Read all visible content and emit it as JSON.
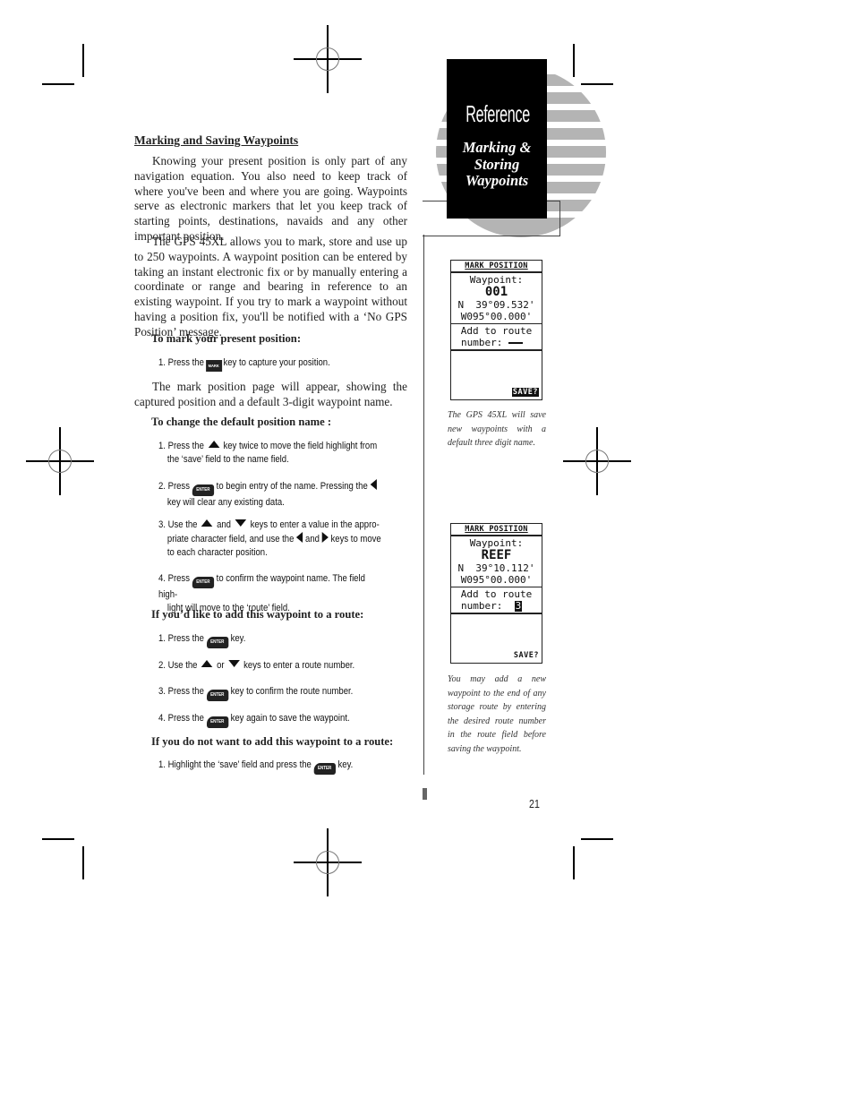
{
  "tab": {
    "title": "Reference",
    "subtitle_lines": [
      "Marking &",
      "Storing",
      "Waypoints"
    ]
  },
  "section": {
    "heading": "Marking and Saving Waypoints",
    "paragraphs": [
      "Knowing your present position is only part of any navigation equation. You also need to keep track of where you've been and where you are going. Waypoints serve as electronic markers that let you keep track of starting points, destinations, navaids and any other important position.",
      "The GPS 45XL allows you to mark, store and use up to 250 waypoints. A waypoint position can be entered by taking an instant electronic fix or by manually entering a coordinate or range and bearing in reference to an existing waypoint. If you try to mark a waypoint without having a position fix, you'll be notified with a ‘No GPS Position’ message.",
      "The mark position page will appear, showing the captured position and a default 3-digit waypoint name."
    ]
  },
  "mark_present": {
    "subheading": "To mark your present position:",
    "step1": {
      "a": "1. Press the",
      "key": "MARK",
      "b": "key to capture your position."
    }
  },
  "change_name": {
    "subheading": "To change the default position name :",
    "step1": {
      "a": "1. Press the",
      "b": "key twice to move the field highlight from",
      "c": "the ‘save’ field to the name field."
    },
    "step2": {
      "a": "2. Press",
      "key": "ENTER",
      "b": "to begin entry of the name. Pressing the",
      "c": "key will clear any existing data."
    },
    "step3": {
      "a": "3. Use the",
      "b": "and",
      "c": "keys to enter a value in the appro-",
      "d": "priate character field, and use the",
      "e": "and",
      "f": "keys to move",
      "g": "to each character position."
    },
    "step4": {
      "a": "4. Press",
      "key": "ENTER",
      "b": "to confirm the waypoint name. The field high-",
      "c": "light will move to the ‘route’ field."
    }
  },
  "add_route": {
    "subheading": "If you’d like to add this waypoint to a route:",
    "step1": {
      "a": "1. Press the",
      "key": "ENTER",
      "b": "key."
    },
    "step2": {
      "a": "2. Use the",
      "b": "or",
      "c": "keys to enter a route number."
    },
    "step3": {
      "a": "3. Press the",
      "key": "ENTER",
      "b": "key to confirm the route number."
    },
    "step4": {
      "a": "4. Press the",
      "key": "ENTER",
      "b": "key again to save the waypoint."
    }
  },
  "no_route": {
    "subheading": "If you do not want to add this waypoint to a route:",
    "step1": {
      "a": "1. Highlight the ‘save’ field and press the",
      "key": "ENTER",
      "b": "key."
    }
  },
  "screen1": {
    "header": "MARK POSITION",
    "waypoint_label": "Waypoint:",
    "waypoint_name": "001",
    "lat": "N  39°09.532'",
    "lon": "W095°00.000'",
    "route_label": "Add to route",
    "number_label": "number:",
    "save": "SAVE?",
    "save_highlighted": true
  },
  "screen1_caption": "The GPS 45XL will save new waypoints with a default three digit name.",
  "screen2": {
    "header": "MARK POSITION",
    "waypoint_label": "Waypoint:",
    "waypoint_name": "REEF",
    "lat": "N  39°10.112'",
    "lon": "W095°00.000'",
    "route_label": "Add to route",
    "number_label": "number:",
    "route_number": "3",
    "save": "SAVE?",
    "save_highlighted": false
  },
  "screen2_caption": "You may add a new waypoint to the end of any storage route by entering the desired route number in the route field before saving the waypoint.",
  "page_number": "21"
}
